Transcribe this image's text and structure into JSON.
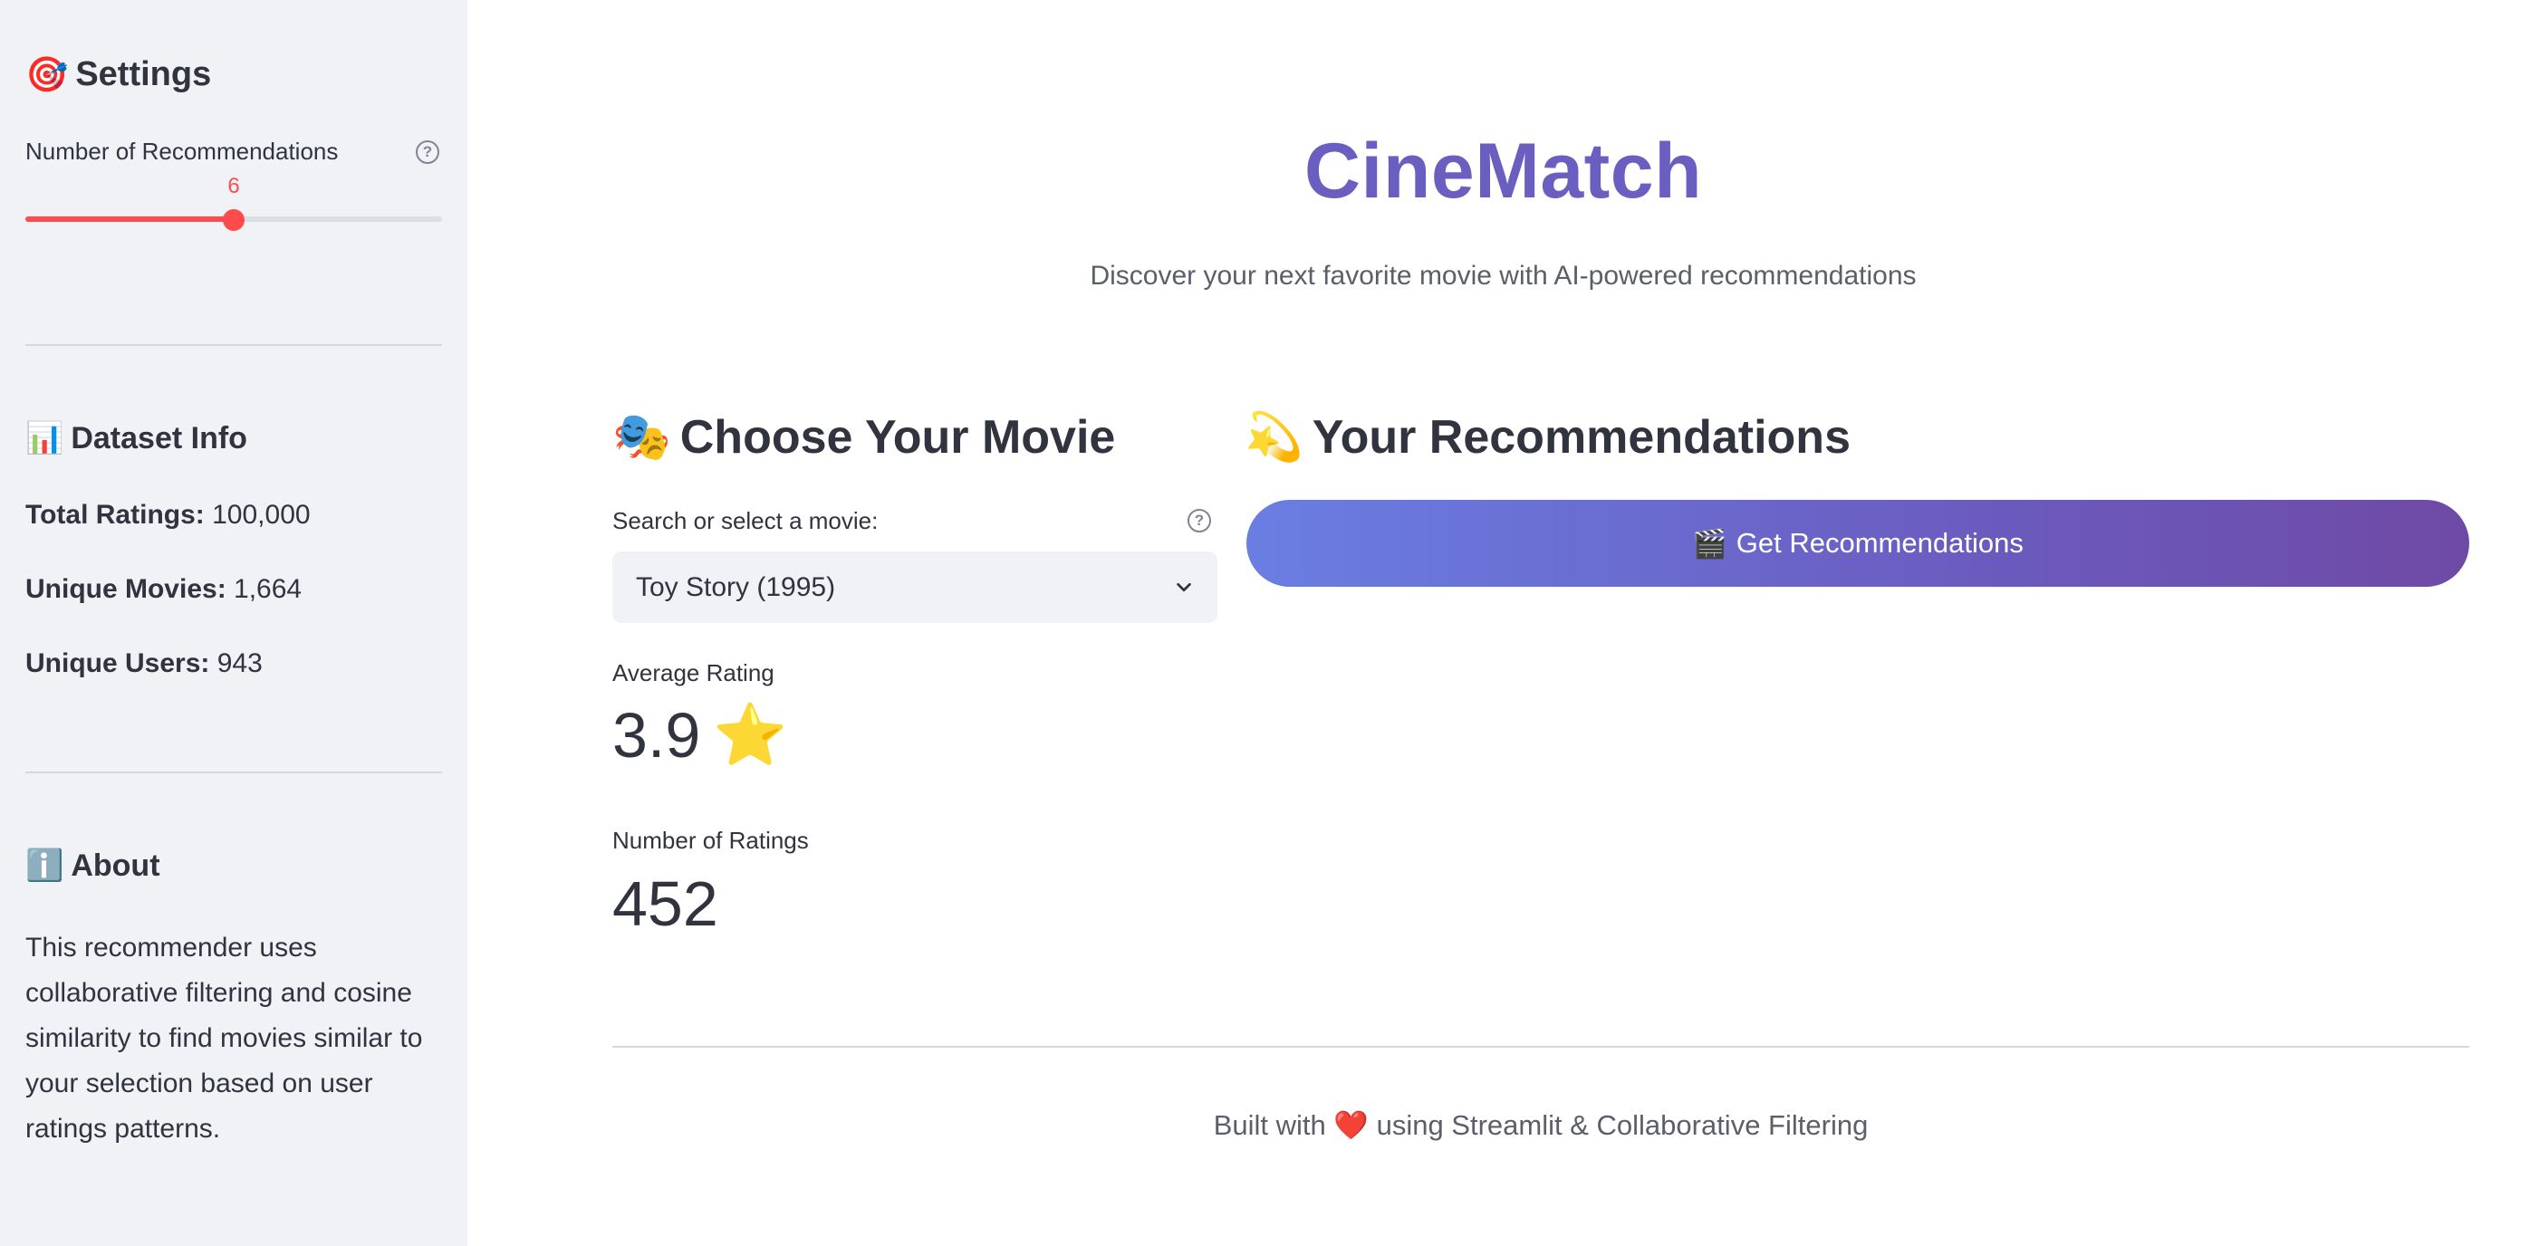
{
  "sidebar": {
    "settings": {
      "icon": "dart-target-icon",
      "glyph": "🎯",
      "title": "Settings"
    },
    "slider": {
      "label": "Number of Recommendations",
      "value": "6",
      "min": 1,
      "max": 11,
      "help_glyph": "?"
    },
    "dataset": {
      "icon": "bar-chart-icon",
      "glyph": "📊",
      "title": "Dataset Info",
      "total_ratings_label": "Total Ratings:",
      "total_ratings_value": " 100,000",
      "unique_movies_label": "Unique Movies:",
      "unique_movies_value": " 1,664",
      "unique_users_label": "Unique Users:",
      "unique_users_value": " 943"
    },
    "about": {
      "icon": "info-icon",
      "glyph": "ℹ️",
      "title": "About",
      "text": "This recommender uses collaborative filtering and cosine similarity to find movies similar to your selection based on user ratings patterns."
    }
  },
  "main": {
    "title": "CineMatch",
    "subtitle": "Discover your next favorite movie with AI-powered recommendations",
    "choose": {
      "icon": "theater-masks-icon",
      "glyph": "🎭",
      "heading": "Choose Your Movie",
      "select_label": "Search or select a movie:",
      "selected": "Toy Story (1995)",
      "help_glyph": "?"
    },
    "metrics": {
      "avg_label": "Average Rating",
      "avg_value": "3.9",
      "avg_icon": "star-icon",
      "avg_glyph": "⭐",
      "count_label": "Number of Ratings",
      "count_value": "452"
    },
    "recommendations": {
      "icon": "dizzy-icon",
      "glyph": "💫",
      "heading": "Your Recommendations",
      "button_icon": "clapper-board-icon",
      "button_glyph": "🎬",
      "button_label": "Get Recommendations"
    },
    "footer": {
      "prefix": "Built with ",
      "heart_icon": "heart-icon",
      "heart_glyph": "❤️",
      "suffix": " using Streamlit & Collaborative Filtering"
    }
  },
  "colors": {
    "accent": "#ff4b4b",
    "title": "#6a5fc1",
    "button_start": "#6a7ee2",
    "button_end": "#6e4aa5",
    "sidebar_bg": "#f0f2f6"
  }
}
